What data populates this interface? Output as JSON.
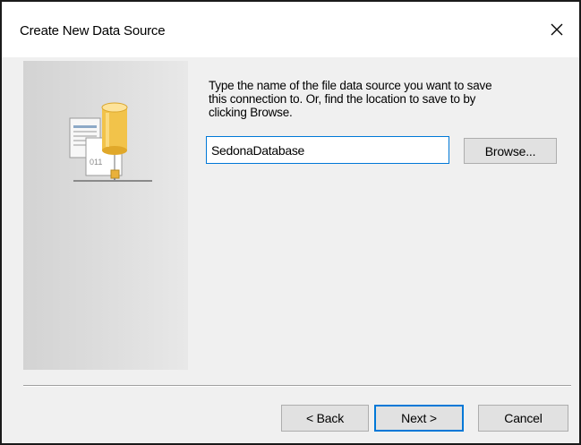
{
  "window": {
    "title": "Create New Data Source",
    "close_glyph": "✕"
  },
  "instructions": "Type the name of the file data source you want to save\nthis connection to.  Or, find the location to save to by\nclicking Browse.",
  "datasource_name": {
    "value": "SedonaDatabase"
  },
  "buttons": {
    "browse": "Browse...",
    "back": "< Back",
    "next": "Next >",
    "cancel": "Cancel"
  },
  "icon": {
    "name": "data-source-icon",
    "binary_text": "011"
  },
  "colors": {
    "focus_accent": "#0078d7",
    "button_face": "#e1e1e1",
    "dialog_background": "#f0f0f0"
  }
}
